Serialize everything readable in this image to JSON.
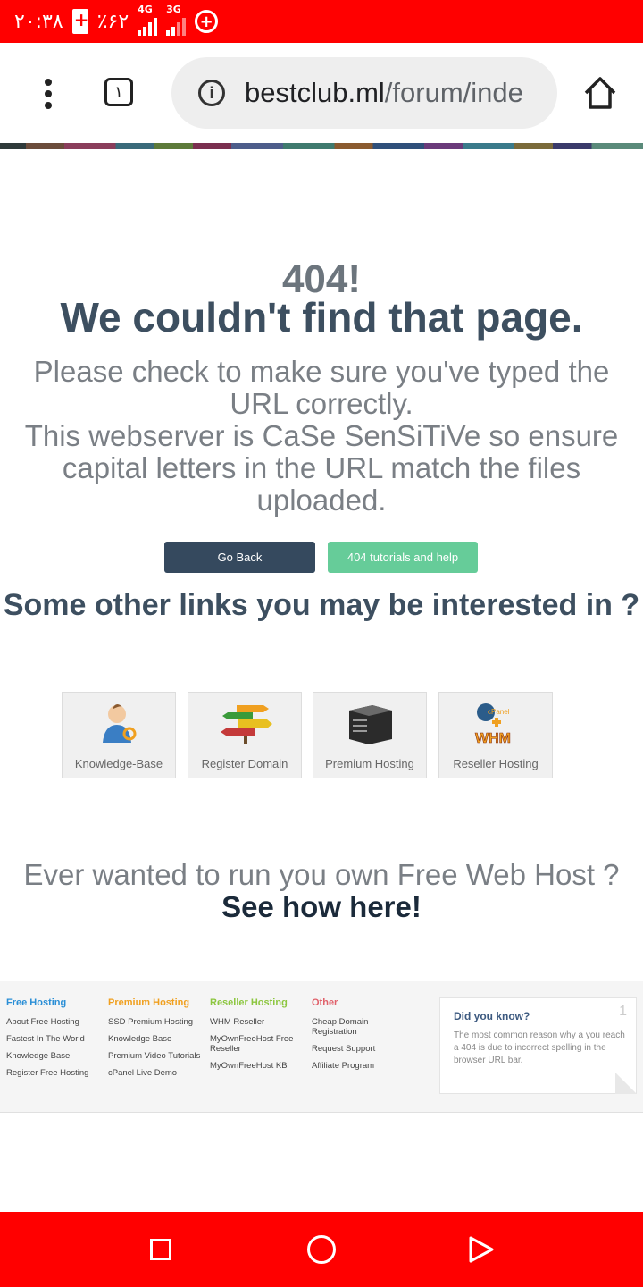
{
  "status_bar": {
    "time": "۲۰:۳۸",
    "battery": "٪۶۲",
    "network1": "4G",
    "network2": "3G"
  },
  "browser": {
    "tab_count": "۱",
    "url_domain": "bestclub.ml",
    "url_path": "/forum/inde"
  },
  "error": {
    "code": "404!",
    "headline": "We couldn't find that page.",
    "message_line1": "Please check to make sure you've typed the URL correctly.",
    "message_line2": "This webserver is CaSe SenSiTiVe so ensure capital letters in the URL match the files uploaded."
  },
  "buttons": {
    "back": "Go Back",
    "help": "404 tutorials and help"
  },
  "other_links": {
    "title": "Some other links you may be interested in ?",
    "items": [
      {
        "label": "Knowledge-Base",
        "icon": "support-person-icon"
      },
      {
        "label": "Register Domain",
        "icon": "domain-signpost-icon"
      },
      {
        "label": "Premium Hosting",
        "icon": "server-icon"
      },
      {
        "label": "Reseller Hosting",
        "icon": "cpanel-whm-icon"
      }
    ]
  },
  "promo": {
    "line1": "Ever wanted to run you own Free Web Host ?",
    "line2": "See how here!"
  },
  "footer": {
    "columns": [
      {
        "heading": "Free Hosting",
        "color": "#2b8fd6",
        "items": [
          "About Free Hosting",
          "Fastest In The World",
          "Knowledge Base",
          "Register Free Hosting"
        ]
      },
      {
        "heading": "Premium Hosting",
        "color": "#f0a020",
        "items": [
          "SSD Premium Hosting",
          "Knowledge Base",
          "Premium Video Tutorials",
          "cPanel Live Demo"
        ]
      },
      {
        "heading": "Reseller Hosting",
        "color": "#8cc63f",
        "items": [
          "WHM Reseller",
          "MyOwnFreeHost Free Reseller",
          "MyOwnFreeHost KB"
        ]
      },
      {
        "heading": "Other",
        "color": "#e0606a",
        "items": [
          "Cheap Domain Registration",
          "Request Support",
          "Affiliate Program"
        ]
      }
    ],
    "did_you_know": {
      "title": "Did you know?",
      "number": "1",
      "body": "The most common reason why a you reach a 404 is due to incorrect spelling in the browser URL bar."
    }
  },
  "colors": {
    "status_bar": "#ff0000",
    "nav_bar": "#ff0000",
    "button_dark": "#35495e",
    "button_green": "#66cc99"
  }
}
